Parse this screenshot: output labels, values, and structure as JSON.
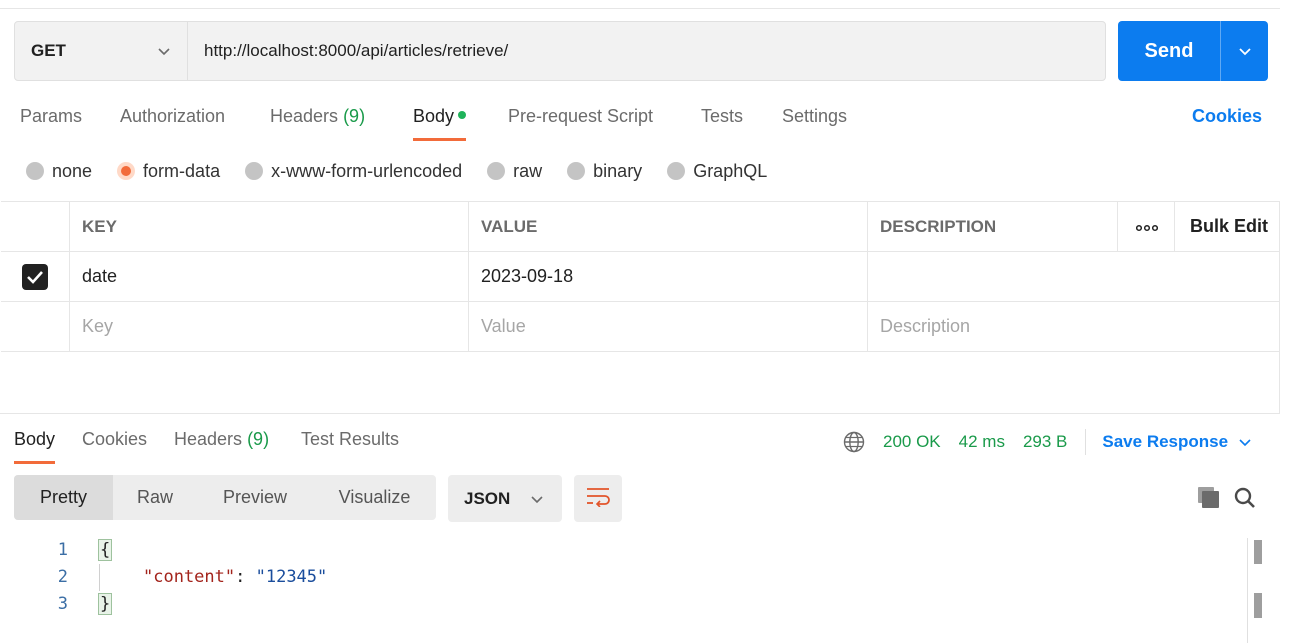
{
  "request": {
    "method": "GET",
    "url": "http://localhost:8000/api/articles/retrieve/",
    "send_label": "Send"
  },
  "request_tabs": {
    "params": "Params",
    "authorization": "Authorization",
    "headers": "Headers",
    "headers_count": "(9)",
    "body": "Body",
    "prerequest": "Pre-request Script",
    "tests": "Tests",
    "settings": "Settings",
    "cookies": "Cookies"
  },
  "body_types": {
    "selected": "form-data",
    "options": [
      "none",
      "form-data",
      "x-www-form-urlencoded",
      "raw",
      "binary",
      "GraphQL"
    ]
  },
  "params_table": {
    "headers": {
      "key": "KEY",
      "value": "VALUE",
      "description": "DESCRIPTION",
      "bulk_edit": "Bulk Edit"
    },
    "rows": [
      {
        "checked": true,
        "key": "date",
        "value": "2023-09-18",
        "description": ""
      }
    ],
    "placeholders": {
      "key": "Key",
      "value": "Value",
      "description": "Description"
    }
  },
  "response_tabs": {
    "body": "Body",
    "cookies": "Cookies",
    "headers": "Headers",
    "headers_count": "(9)",
    "test_results": "Test Results"
  },
  "response_meta": {
    "status": "200 OK",
    "time": "42 ms",
    "size": "293 B",
    "save_label": "Save Response"
  },
  "view_modes": {
    "options": [
      "Pretty",
      "Raw",
      "Preview",
      "Visualize"
    ],
    "selected": "Pretty",
    "format": "JSON"
  },
  "code": {
    "lines": [
      {
        "num": "1",
        "open": "{"
      },
      {
        "num": "2",
        "key": "\"content\"",
        "sep": ": ",
        "value": "\"12345\""
      },
      {
        "num": "3",
        "close": "}"
      }
    ]
  },
  "colors": {
    "accent": "#f26b3a",
    "primary": "#0c7cef",
    "success": "#1a9a4a"
  }
}
